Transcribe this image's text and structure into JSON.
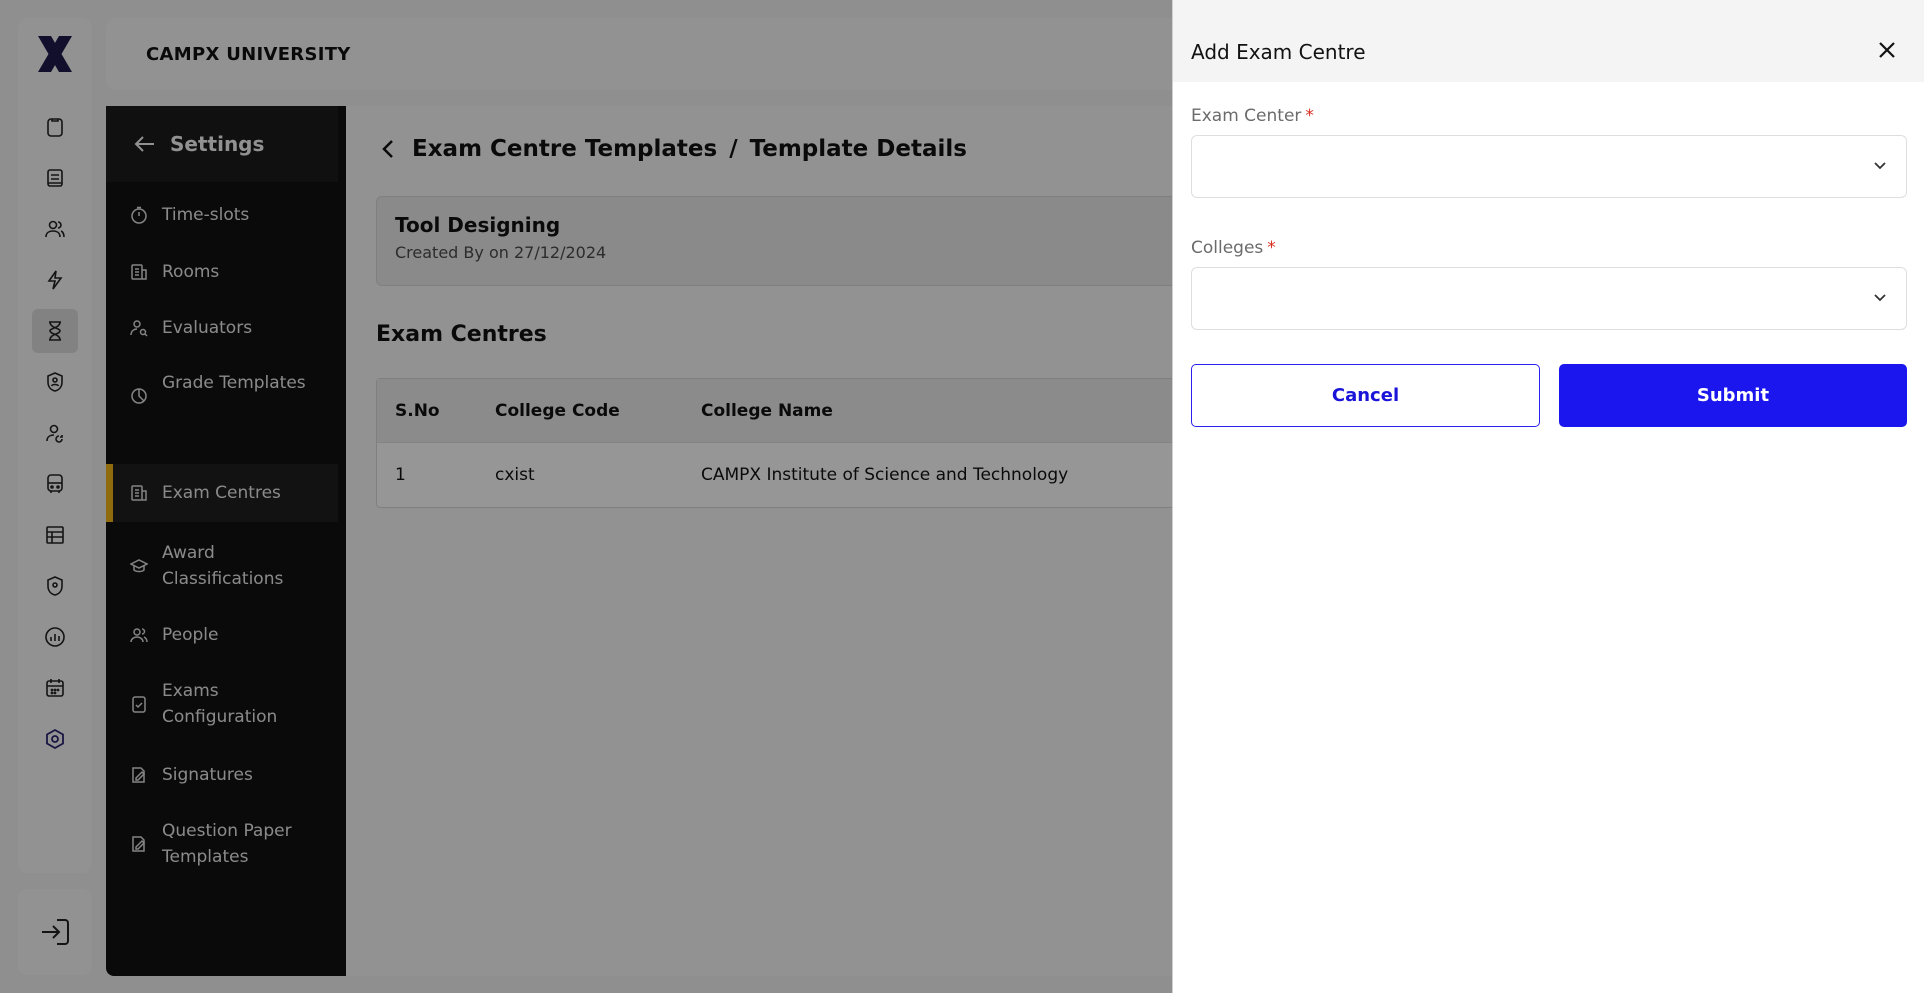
{
  "app": {
    "university": "CAMPX UNIVERSITY"
  },
  "rail": {
    "logo": "campx-logo-icon",
    "icons": [
      "clipboard-icon",
      "book-icon",
      "users-icon",
      "lightning-icon",
      "hourglass-icon",
      "shield-user-icon",
      "user-refresh-icon",
      "bus-icon",
      "table-icon",
      "location-shield-icon",
      "chart-icon",
      "calendar-icon",
      "settings-hex-icon"
    ],
    "active": "hourglass-icon",
    "bottom_icon": "logout-icon"
  },
  "settings": {
    "title": "Settings",
    "items": [
      {
        "label": "Time-slots",
        "icon": "timer-icon"
      },
      {
        "label": "Rooms",
        "icon": "building-icon"
      },
      {
        "label": "Evaluators",
        "icon": "user-search-icon"
      },
      {
        "label": "Grade Templates",
        "icon": "grade-icon"
      },
      {
        "label": "Exam Centres",
        "icon": "building-icon",
        "active": true
      },
      {
        "label": "Award Classifications",
        "icon": "graduation-cap-icon"
      },
      {
        "label": "People",
        "icon": "people-icon"
      },
      {
        "label": "Exams Configuration",
        "icon": "clipboard-check-icon"
      },
      {
        "label": "Signatures",
        "icon": "signature-icon"
      },
      {
        "label": "Question Paper Templates",
        "icon": "signature-icon"
      }
    ]
  },
  "main": {
    "breadcrumb": {
      "parent": "Exam Centre Templates",
      "separator": "/",
      "current": "Template Details"
    },
    "template": {
      "name": "Tool Designing",
      "meta": "Created By on 27/12/2024"
    },
    "section_title": "Exam Centres",
    "table": {
      "headers": [
        "S.No",
        "College Code",
        "College Name"
      ],
      "rows": [
        [
          "1",
          "cxist",
          "CAMPX Institute of Science and Technology"
        ]
      ]
    }
  },
  "drawer": {
    "title": "Add Exam Centre",
    "exam_center_label": "Exam Center",
    "colleges_label": "Colleges",
    "required_marker": "*",
    "exam_center_value": "",
    "colleges_value": "",
    "cancel_label": "Cancel",
    "submit_label": "Submit"
  },
  "colors": {
    "accent": "#f1b317",
    "primary": "#1c16ee",
    "required": "#d92d20"
  }
}
